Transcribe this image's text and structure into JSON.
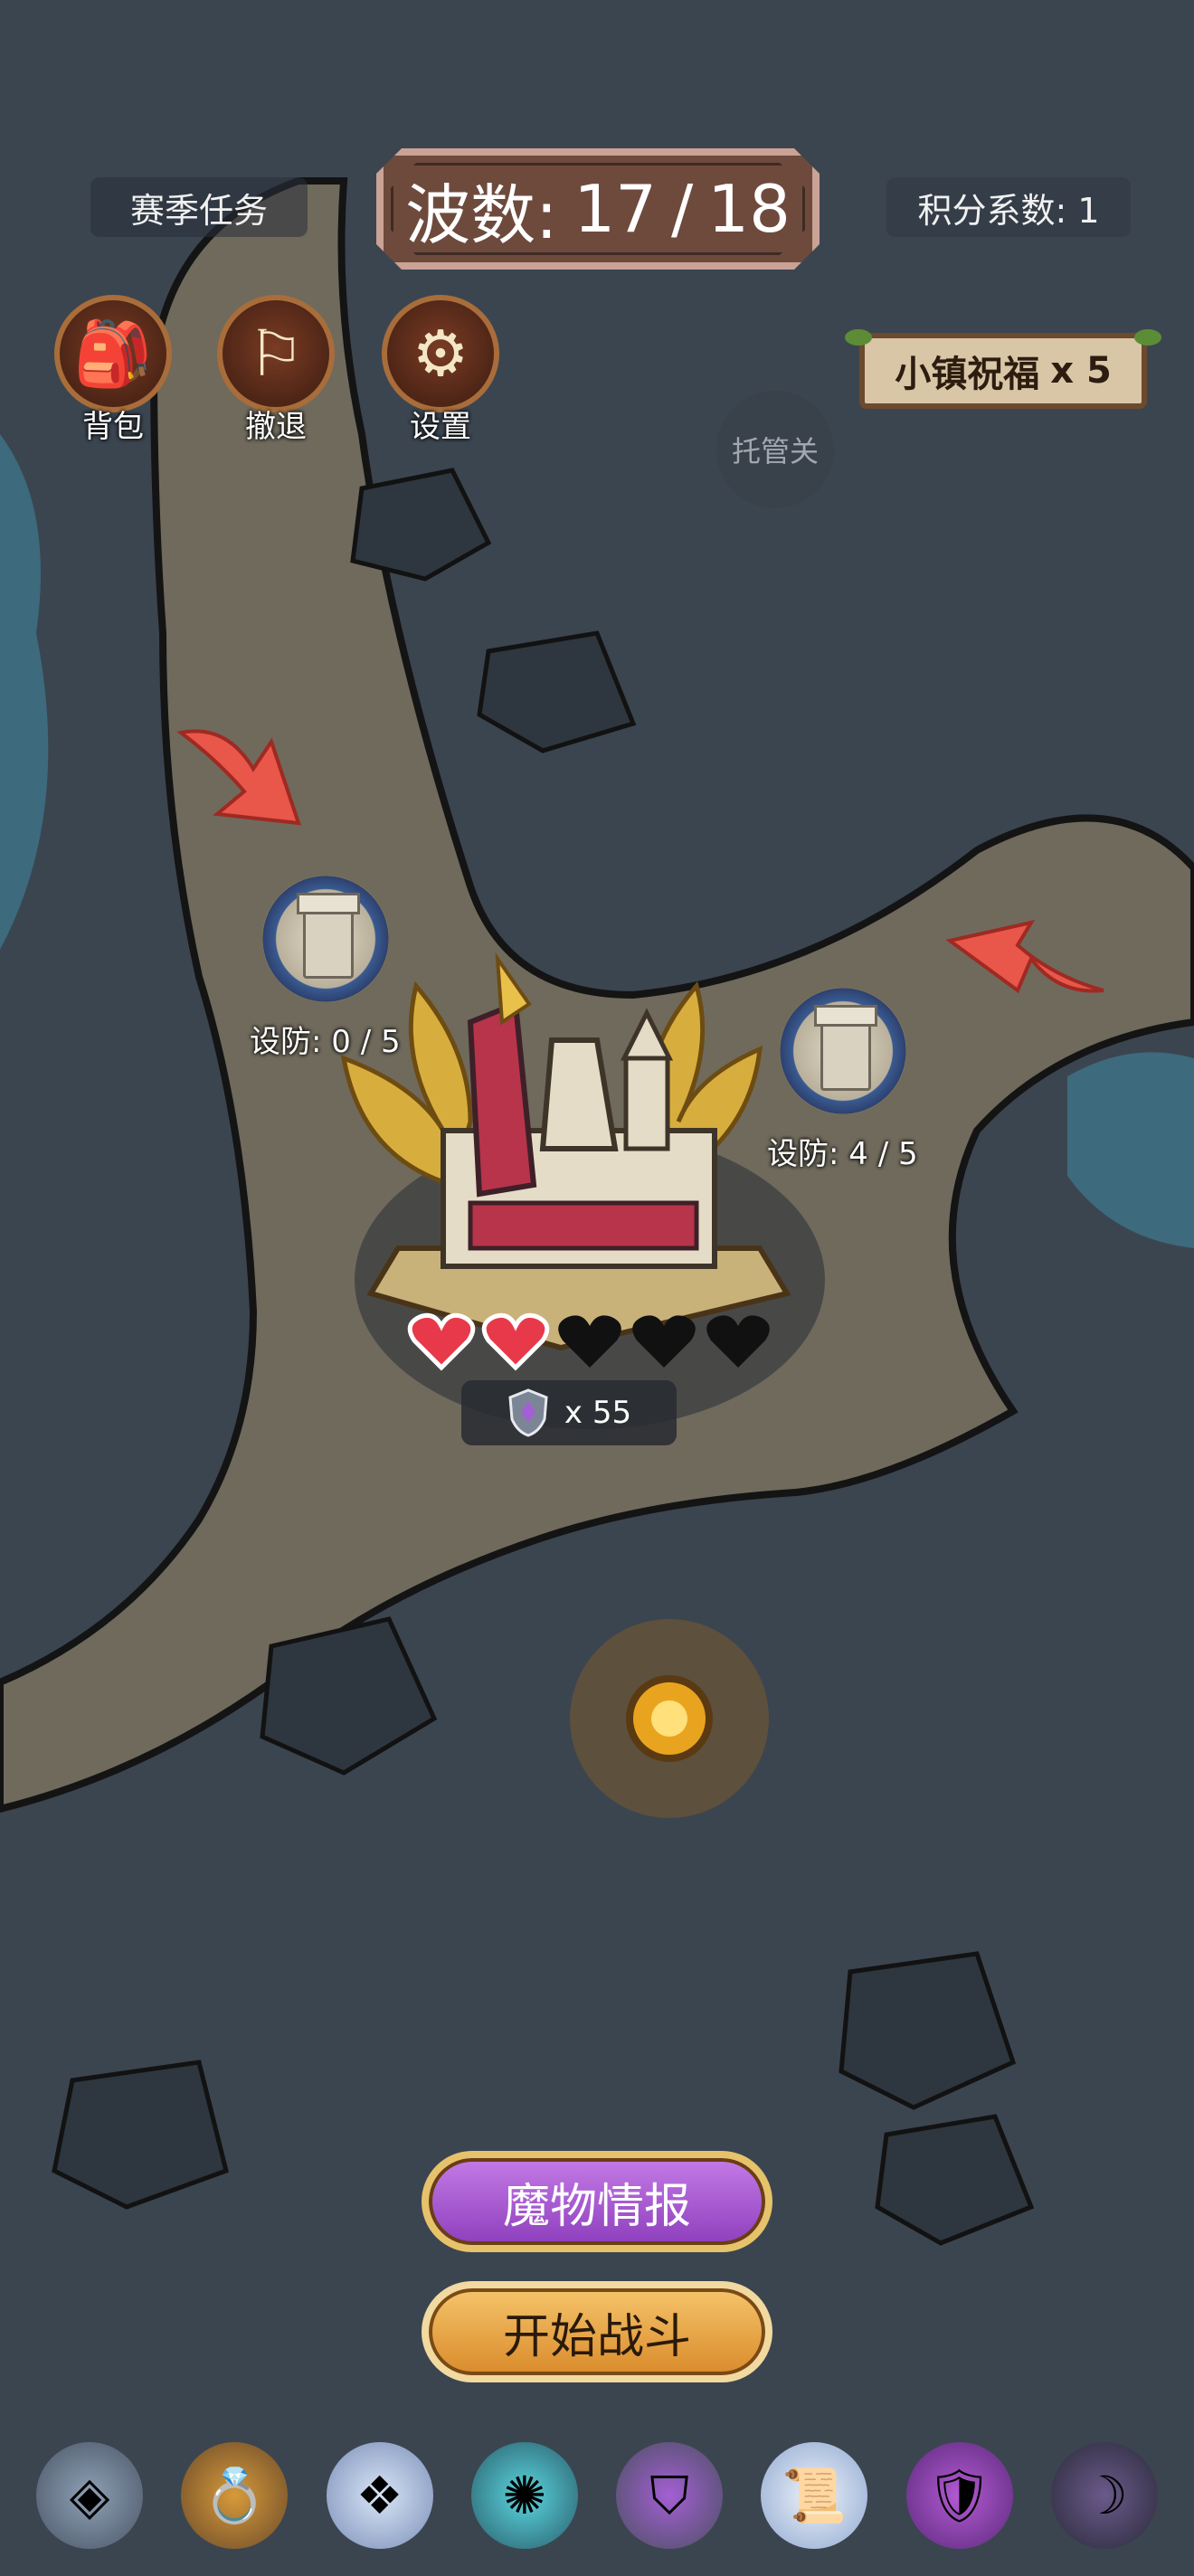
{
  "header": {
    "season_task": "赛季任务",
    "wave_label": "波数:",
    "wave_current": "17",
    "wave_separator": "/",
    "wave_total": "18",
    "score_coefficient": "积分系数: 1"
  },
  "toolbar": {
    "backpack": {
      "label": "背包",
      "icon": "backpack-icon"
    },
    "retreat": {
      "label": "撤退",
      "icon": "white-flag-icon"
    },
    "settings": {
      "label": "设置",
      "icon": "gear-icon"
    }
  },
  "blessing": {
    "label": "小镇祝福",
    "count": "x 5"
  },
  "auto_button": {
    "label": "托管关"
  },
  "tower_slots": [
    {
      "defense": "设防: 0 / 5"
    },
    {
      "defense": "设防: 4 / 5"
    }
  ],
  "base": {
    "hearts_total": 5,
    "hearts_filled": 2,
    "token_count": "x 55"
  },
  "buttons": {
    "monster_info": "魔物情报",
    "start_battle": "开始战斗"
  },
  "items": [
    {
      "icon": "rune-stone-icon"
    },
    {
      "icon": "amber-ring-icon"
    },
    {
      "icon": "crystal-ring-icon"
    },
    {
      "icon": "orbit-ring-icon"
    },
    {
      "icon": "rank-shield-icon"
    },
    {
      "icon": "scroll-icon"
    },
    {
      "icon": "purple-shield-icon"
    },
    {
      "icon": "scythe-icon"
    }
  ],
  "colors": {
    "map_bg": "#3b4550",
    "path": "#6f6a5c",
    "heart_filled": "#e8394a",
    "heart_empty": "#111111",
    "arrow": "#e9564a"
  }
}
